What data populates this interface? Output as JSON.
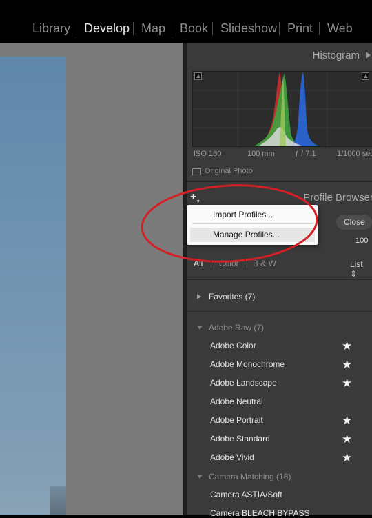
{
  "modules": [
    "Library",
    "Develop",
    "Map",
    "Book",
    "Slideshow",
    "Print",
    "Web"
  ],
  "active_module": "Develop",
  "histogram": {
    "title": "Histogram",
    "iso": "ISO 160",
    "focal_length": "100 mm",
    "aperture": "ƒ / 7.1",
    "shutter": "1/1000 sec",
    "original_photo_label": "Original Photo"
  },
  "profile_browser": {
    "title": "Profile Browser",
    "close_label": "Close",
    "amount": "100",
    "filters": [
      "All",
      "Color",
      "B & W"
    ],
    "view_label": "List ⇕",
    "favorites_label": "Favorites (7)",
    "adobe_raw_label": "Adobe Raw (7)",
    "adobe_raw_profiles": [
      {
        "name": "Adobe Color",
        "favorite": true
      },
      {
        "name": "Adobe Monochrome",
        "favorite": true
      },
      {
        "name": "Adobe Landscape",
        "favorite": true
      },
      {
        "name": "Adobe Neutral",
        "favorite": false
      },
      {
        "name": "Adobe Portrait",
        "favorite": true
      },
      {
        "name": "Adobe Standard",
        "favorite": true
      },
      {
        "name": "Adobe Vivid",
        "favorite": true
      }
    ],
    "camera_matching_label": "Camera Matching (18)",
    "camera_profiles": [
      "Camera ASTIA/Soft",
      "Camera BLEACH BYPASS"
    ]
  },
  "context_menu": {
    "import_label": "Import Profiles...",
    "manage_label": "Manage Profiles..."
  },
  "icons": {
    "star": "★",
    "plus": "+"
  },
  "colors": {
    "annotation": "#d41f26",
    "histogram_red": "#c0302b",
    "histogram_green": "#3fa33f",
    "histogram_blue": "#2a62c9"
  }
}
